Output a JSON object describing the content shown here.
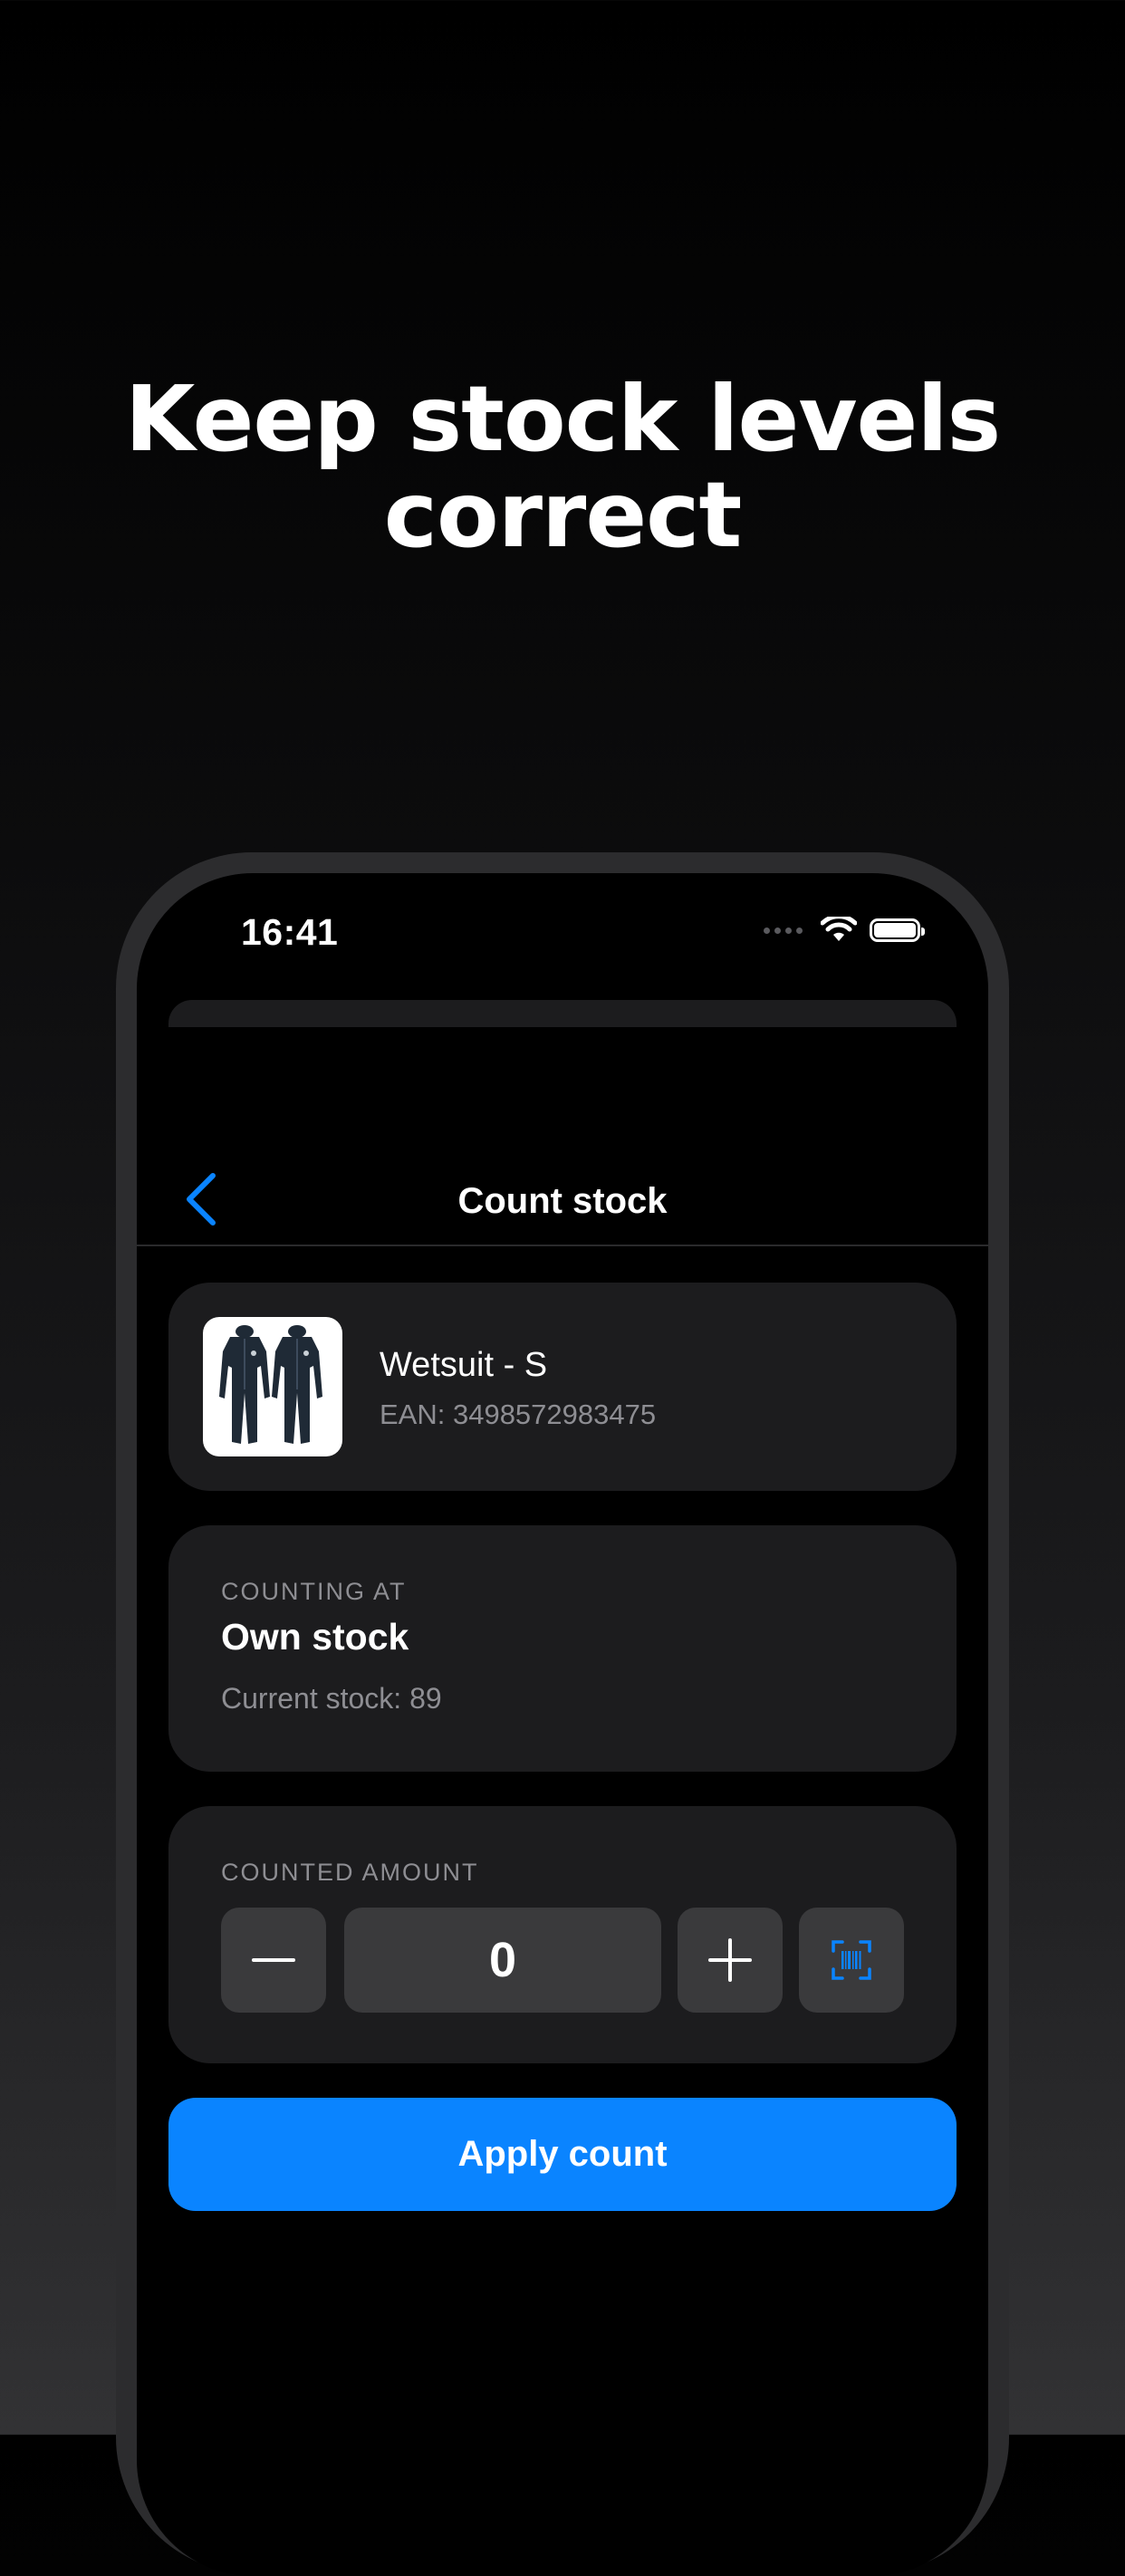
{
  "headline": {
    "line1": "Keep stock levels",
    "line2": "correct"
  },
  "status_bar": {
    "time": "16:41"
  },
  "nav": {
    "title": "Count stock"
  },
  "product": {
    "name": "Wetsuit - S",
    "ean": "EAN: 3498572983475"
  },
  "location": {
    "label": "COUNTING AT",
    "name": "Own stock",
    "current_stock": "Current stock: 89"
  },
  "counted": {
    "label": "COUNTED AMOUNT",
    "value": "0"
  },
  "actions": {
    "apply_label": "Apply count"
  },
  "colors": {
    "accent": "#0a84ff",
    "card": "#1c1c1e",
    "control": "#3a3a3c",
    "secondary_text": "#8e8e93"
  }
}
